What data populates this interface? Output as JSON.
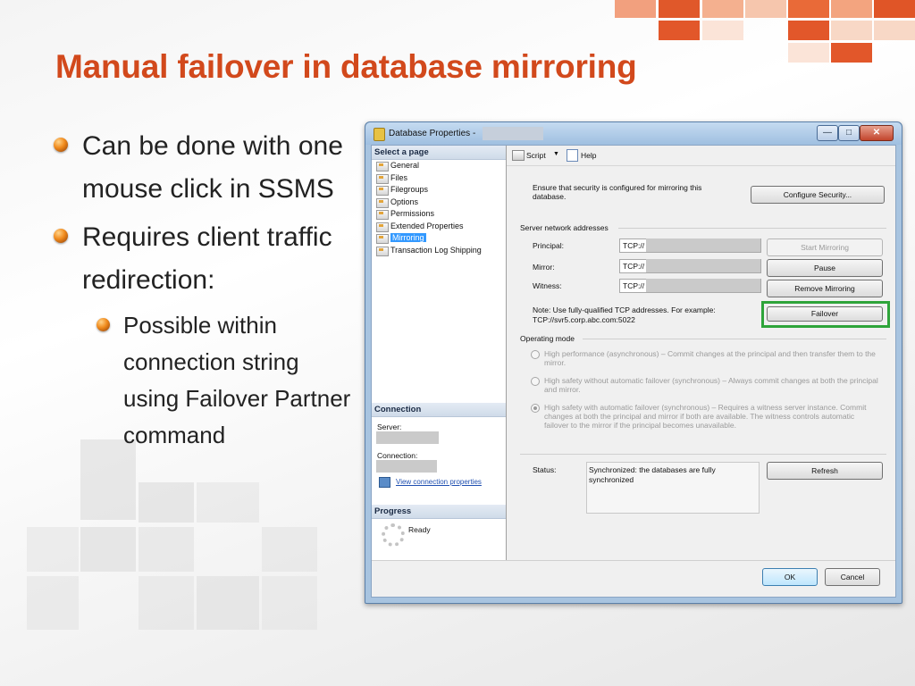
{
  "slide": {
    "title": "Manual failover in database mirroring",
    "bullets": [
      {
        "text": "Can be done with one mouse click in SSMS"
      },
      {
        "text": "Requires client traffic redirection:"
      }
    ],
    "sub_bullets": [
      {
        "text": "Possible within connection string using Failover Partner command"
      }
    ],
    "accent_color": "#d2491c",
    "highlight_color": "#2ea43a"
  },
  "dialog": {
    "title": "Database Properties - ",
    "select_page_header": "Select a page",
    "pages": [
      "General",
      "Files",
      "Filegroups",
      "Options",
      "Permissions",
      "Extended Properties",
      "Mirroring",
      "Transaction Log Shipping"
    ],
    "selected_page": "Mirroring",
    "toolbar": {
      "script": "Script",
      "help": "Help"
    },
    "connection": {
      "header": "Connection",
      "server_label": "Server:",
      "connection_label": "Connection:",
      "view_link": "View connection properties"
    },
    "progress": {
      "header": "Progress",
      "status": "Ready"
    },
    "security_text": "Ensure that security is configured for mirroring this database.",
    "configure_security": "Configure Security...",
    "server_network_addresses": "Server network addresses",
    "principal_label": "Principal:",
    "mirror_label": "Mirror:",
    "witness_label": "Witness:",
    "tcp_prefix": "TCP://",
    "start_mirroring": "Start Mirroring",
    "pause": "Pause",
    "remove_mirroring": "Remove Mirroring",
    "note": "Note: Use fully-qualified TCP addresses. For example: TCP://svr5.corp.abc.com:5022",
    "failover": "Failover",
    "operating_mode": "Operating mode",
    "mode_high_performance": "High performance (asynchronous) – Commit changes at the principal and then transfer them to the mirror.",
    "mode_high_safety_no_auto": "High safety without automatic failover (synchronous) – Always commit changes at both the principal and mirror.",
    "mode_high_safety_auto": "High safety with automatic failover (synchronous) – Requires a witness server instance. Commit changes at both the principal and mirror if both are available. The witness controls automatic failover to the mirror if the principal becomes unavailable.",
    "status_label": "Status:",
    "status_value": "Synchronized: the databases are fully synchronized",
    "refresh": "Refresh",
    "ok": "OK",
    "cancel": "Cancel"
  }
}
